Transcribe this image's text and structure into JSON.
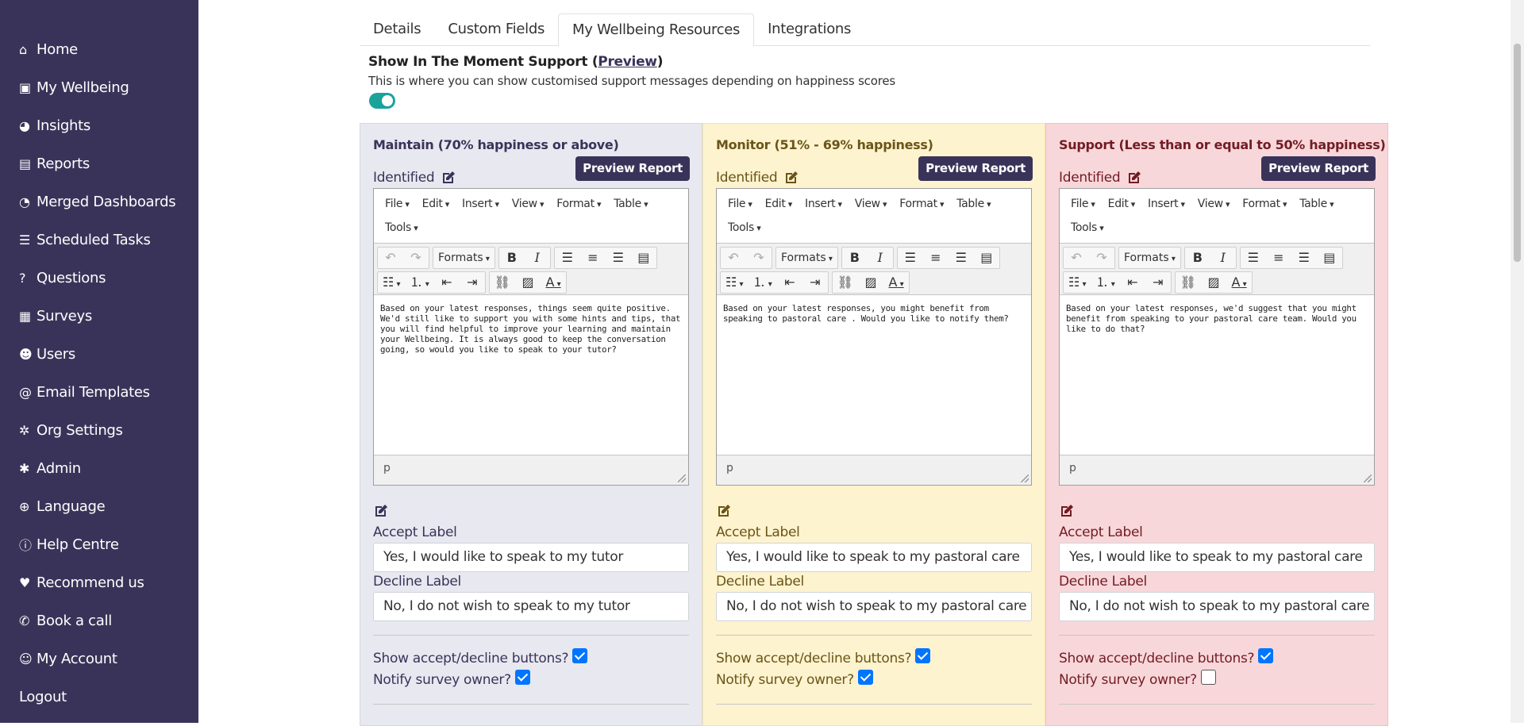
{
  "sidebar": {
    "items": [
      {
        "label": "Home",
        "icon": "home-icon",
        "glyph": "⌂"
      },
      {
        "label": "My Wellbeing",
        "icon": "briefcase-icon",
        "glyph": "▣"
      },
      {
        "label": "Insights",
        "icon": "pie-chart-icon",
        "glyph": "◕"
      },
      {
        "label": "Reports",
        "icon": "file-icon",
        "glyph": "▤"
      },
      {
        "label": "Merged Dashboards",
        "icon": "gauge-icon",
        "glyph": "◔"
      },
      {
        "label": "Scheduled Tasks",
        "icon": "tasks-icon",
        "glyph": "☰"
      },
      {
        "label": "Questions",
        "icon": "question-icon",
        "glyph": "?"
      },
      {
        "label": "Surveys",
        "icon": "poll-icon",
        "glyph": "▦"
      },
      {
        "label": "Users",
        "icon": "users-icon",
        "glyph": "☻"
      },
      {
        "label": "Email Templates",
        "icon": "at-icon",
        "glyph": "@"
      },
      {
        "label": "Org Settings",
        "icon": "gear-icon",
        "glyph": "✲"
      },
      {
        "label": "Admin",
        "icon": "cogs-icon",
        "glyph": "✱"
      },
      {
        "label": "Language",
        "icon": "globe-icon",
        "glyph": "⊕"
      },
      {
        "label": "Help Centre",
        "icon": "info-icon",
        "glyph": "ⓘ"
      },
      {
        "label": "Recommend us",
        "icon": "heart-icon",
        "glyph": "♥"
      },
      {
        "label": "Book a call",
        "icon": "phone-icon",
        "glyph": "✆"
      },
      {
        "label": "My Account",
        "icon": "user-icon",
        "glyph": "☺"
      },
      {
        "label": "Logout",
        "icon": "",
        "glyph": ""
      }
    ]
  },
  "tabs": [
    "Details",
    "Custom Fields",
    "My Wellbeing Resources",
    "Integrations"
  ],
  "active_tab": "My Wellbeing Resources",
  "section": {
    "title_prefix": "Show In The Moment Support (",
    "preview_link": "Preview",
    "title_suffix": ")",
    "description": "This is where you can show customised support messages depending on happiness scores",
    "toggle_on": true
  },
  "editor": {
    "menus": [
      "File",
      "Edit",
      "Insert",
      "View",
      "Format",
      "Table",
      "Tools"
    ],
    "formats_label": "Formats",
    "status_path": "p"
  },
  "columns": [
    {
      "title": "Maintain (70% happiness or above)",
      "preview_button": "Preview Report",
      "identified_label": "Identified",
      "content": "Based on your latest responses, things seem quite positive. We'd still like to support you with some hints and tips, that you will find helpful to improve your learning and maintain your Wellbeing. It is always good to keep the conversation going, so would you like to speak to your tutor?",
      "accept_label": "Accept Label",
      "accept_value": "Yes, I would like to speak to my tutor",
      "decline_label": "Decline Label",
      "decline_value": "No, I do not wish to speak to my tutor",
      "show_buttons_label": "Show accept/decline buttons?",
      "show_buttons": true,
      "notify_label": "Notify survey owner?",
      "notify": true,
      "color": "#e8e8f0"
    },
    {
      "title": "Monitor (51% - 69% happiness)",
      "preview_button": "Preview Report",
      "identified_label": "Identified",
      "content": "Based on your latest responses, you might benefit from speaking to pastoral care . Would you like to notify them?",
      "accept_label": "Accept Label",
      "accept_value": "Yes, I would like to speak to my pastoral care",
      "decline_label": "Decline Label",
      "decline_value": "No, I do not wish to speak to my pastoral care",
      "show_buttons_label": "Show accept/decline buttons?",
      "show_buttons": true,
      "notify_label": "Notify survey owner?",
      "notify": true,
      "color": "#fdf3cf"
    },
    {
      "title": "Support (Less than or equal to 50% happiness)",
      "preview_button": "Preview Report",
      "identified_label": "Identified",
      "content": "Based on your latest responses, we'd suggest that you might benefit from speaking to your pastoral care team. Would you like to do that?",
      "accept_label": "Accept Label",
      "accept_value": "Yes, I would like to speak to my pastoral care",
      "decline_label": "Decline Label",
      "decline_value": "No, I do not wish to speak to my pastoral care",
      "show_buttons_label": "Show accept/decline buttons?",
      "show_buttons": true,
      "notify_label": "Notify survey owner?",
      "notify": false,
      "color": "#f8d7da"
    }
  ]
}
